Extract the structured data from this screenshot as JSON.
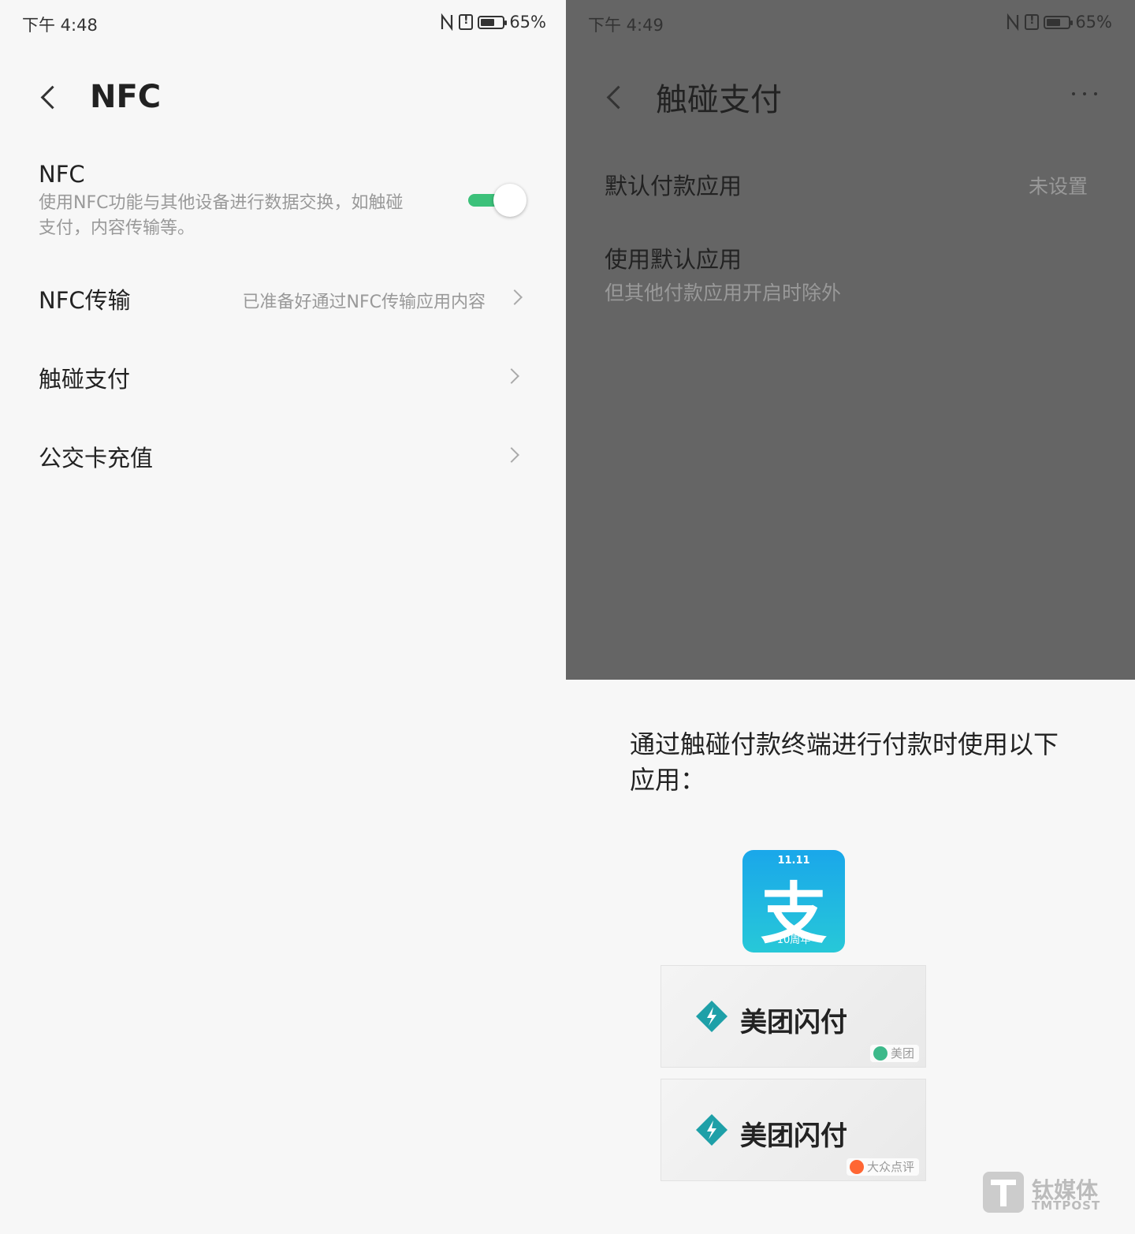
{
  "left": {
    "status": {
      "time": "下午 4:48",
      "battery": "65%",
      "battery_level": 0.65
    },
    "header": {
      "title": "NFC"
    },
    "nfc": {
      "title": "NFC",
      "description": "使用NFC功能与其他设备进行数据交换，如触碰支付，内容传输等。",
      "enabled": true
    },
    "rows": [
      {
        "title": "NFC传输",
        "value": "已准备好通过NFC传输应用内容"
      },
      {
        "title": "触碰支付",
        "value": ""
      },
      {
        "title": "公交卡充值",
        "value": ""
      }
    ]
  },
  "right": {
    "status": {
      "time": "下午 4:49",
      "battery": "65%",
      "battery_level": 0.65
    },
    "header": {
      "title": "触碰支付"
    },
    "default_app": {
      "title": "默认付款应用",
      "value": "未设置"
    },
    "use_default": {
      "title": "使用默认应用",
      "subtitle": "但其他付款应用开启时除外"
    },
    "dialog": {
      "message": "通过触碰付款终端进行付款时使用以下应用：",
      "apps": [
        {
          "name": "支付宝",
          "icon_char": "支",
          "top_label": "11.11",
          "bottom_label": "10周年"
        },
        {
          "name": "美团闪付",
          "brand": "美团"
        },
        {
          "name": "美团闪付",
          "brand": "大众点评"
        }
      ]
    }
  },
  "watermark": {
    "cn": "钛媒体",
    "en": "TMTPOST"
  },
  "colors": {
    "toggle_on": "#3cc17a",
    "overlay": "#656565",
    "alipay_top": "#1aa7ea",
    "alipay_bottom": "#27c8d8",
    "meituan_logo": "#1ea0a8",
    "meituan_dot": "#3cb98a",
    "dianping_dot": "#ff6633"
  },
  "icons": {
    "status_nfc": "nfc-icon",
    "status_alert": "alert-icon",
    "status_battery": "battery-icon",
    "back": "back-icon",
    "chevron": "chevron-right-icon",
    "more": "more-icon",
    "meituan_logo": "meituan-pay-logo"
  }
}
